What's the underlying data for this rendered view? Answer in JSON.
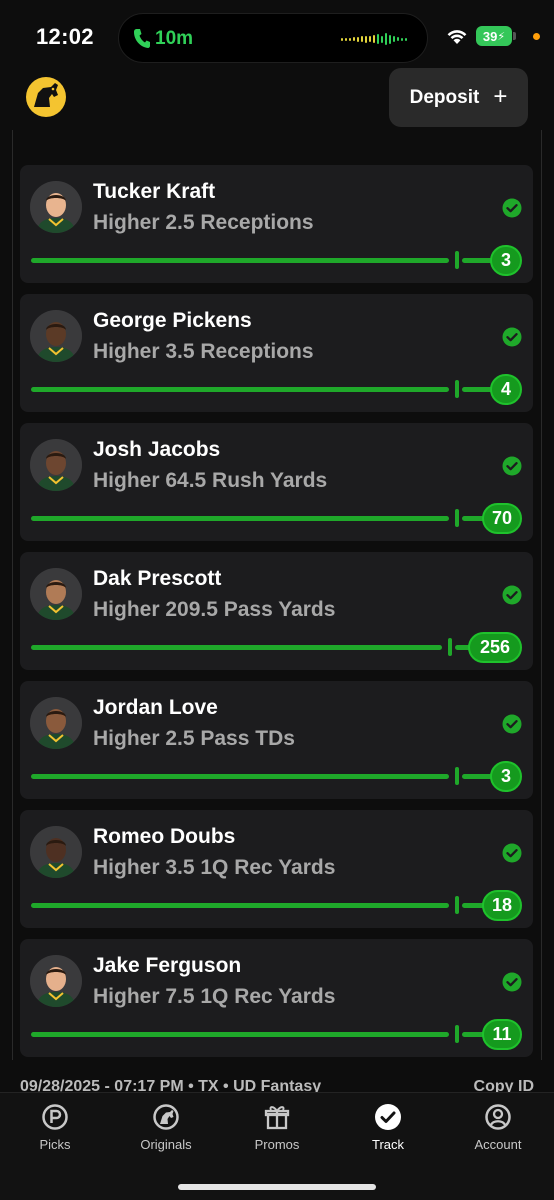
{
  "status_bar": {
    "time": "12:02",
    "call_timer": "10m",
    "battery": "39"
  },
  "header": {
    "deposit_label": "Deposit",
    "deposit_icon": "plus-icon"
  },
  "colors": {
    "accent_green": "#1fa82a",
    "card_bg": "#1c1c1e",
    "background": "#0d0d0d"
  },
  "picks": [
    {
      "player": "Tucker Kraft",
      "line": "Higher 2.5 Receptions",
      "result": "3",
      "status_icon": "check-circle-icon"
    },
    {
      "player": "George Pickens",
      "line": "Higher 3.5 Receptions",
      "result": "4",
      "status_icon": "check-circle-icon"
    },
    {
      "player": "Josh Jacobs",
      "line": "Higher 64.5 Rush Yards",
      "result": "70",
      "status_icon": "check-circle-icon"
    },
    {
      "player": "Dak Prescott",
      "line": "Higher 209.5 Pass Yards",
      "result": "256",
      "status_icon": "check-circle-icon"
    },
    {
      "player": "Jordan Love",
      "line": "Higher 2.5 Pass TDs",
      "result": "3",
      "status_icon": "check-circle-icon"
    },
    {
      "player": "Romeo Doubs",
      "line": "Higher 3.5 1Q Rec Yards",
      "result": "18",
      "status_icon": "check-circle-icon"
    },
    {
      "player": "Jake Ferguson",
      "line": "Higher 7.5 1Q Rec Yards",
      "result": "11",
      "status_icon": "check-circle-icon"
    }
  ],
  "footer": {
    "entry_info": "09/28/2025 - 07:17 PM • TX • UD Fantasy",
    "copy_id": "Copy ID"
  },
  "tabs": [
    {
      "label": "Picks",
      "icon": "picks-icon"
    },
    {
      "label": "Originals",
      "icon": "originals-icon"
    },
    {
      "label": "Promos",
      "icon": "gift-icon"
    },
    {
      "label": "Track",
      "icon": "check-circle-icon",
      "active": true
    },
    {
      "label": "Account",
      "icon": "user-icon"
    }
  ]
}
